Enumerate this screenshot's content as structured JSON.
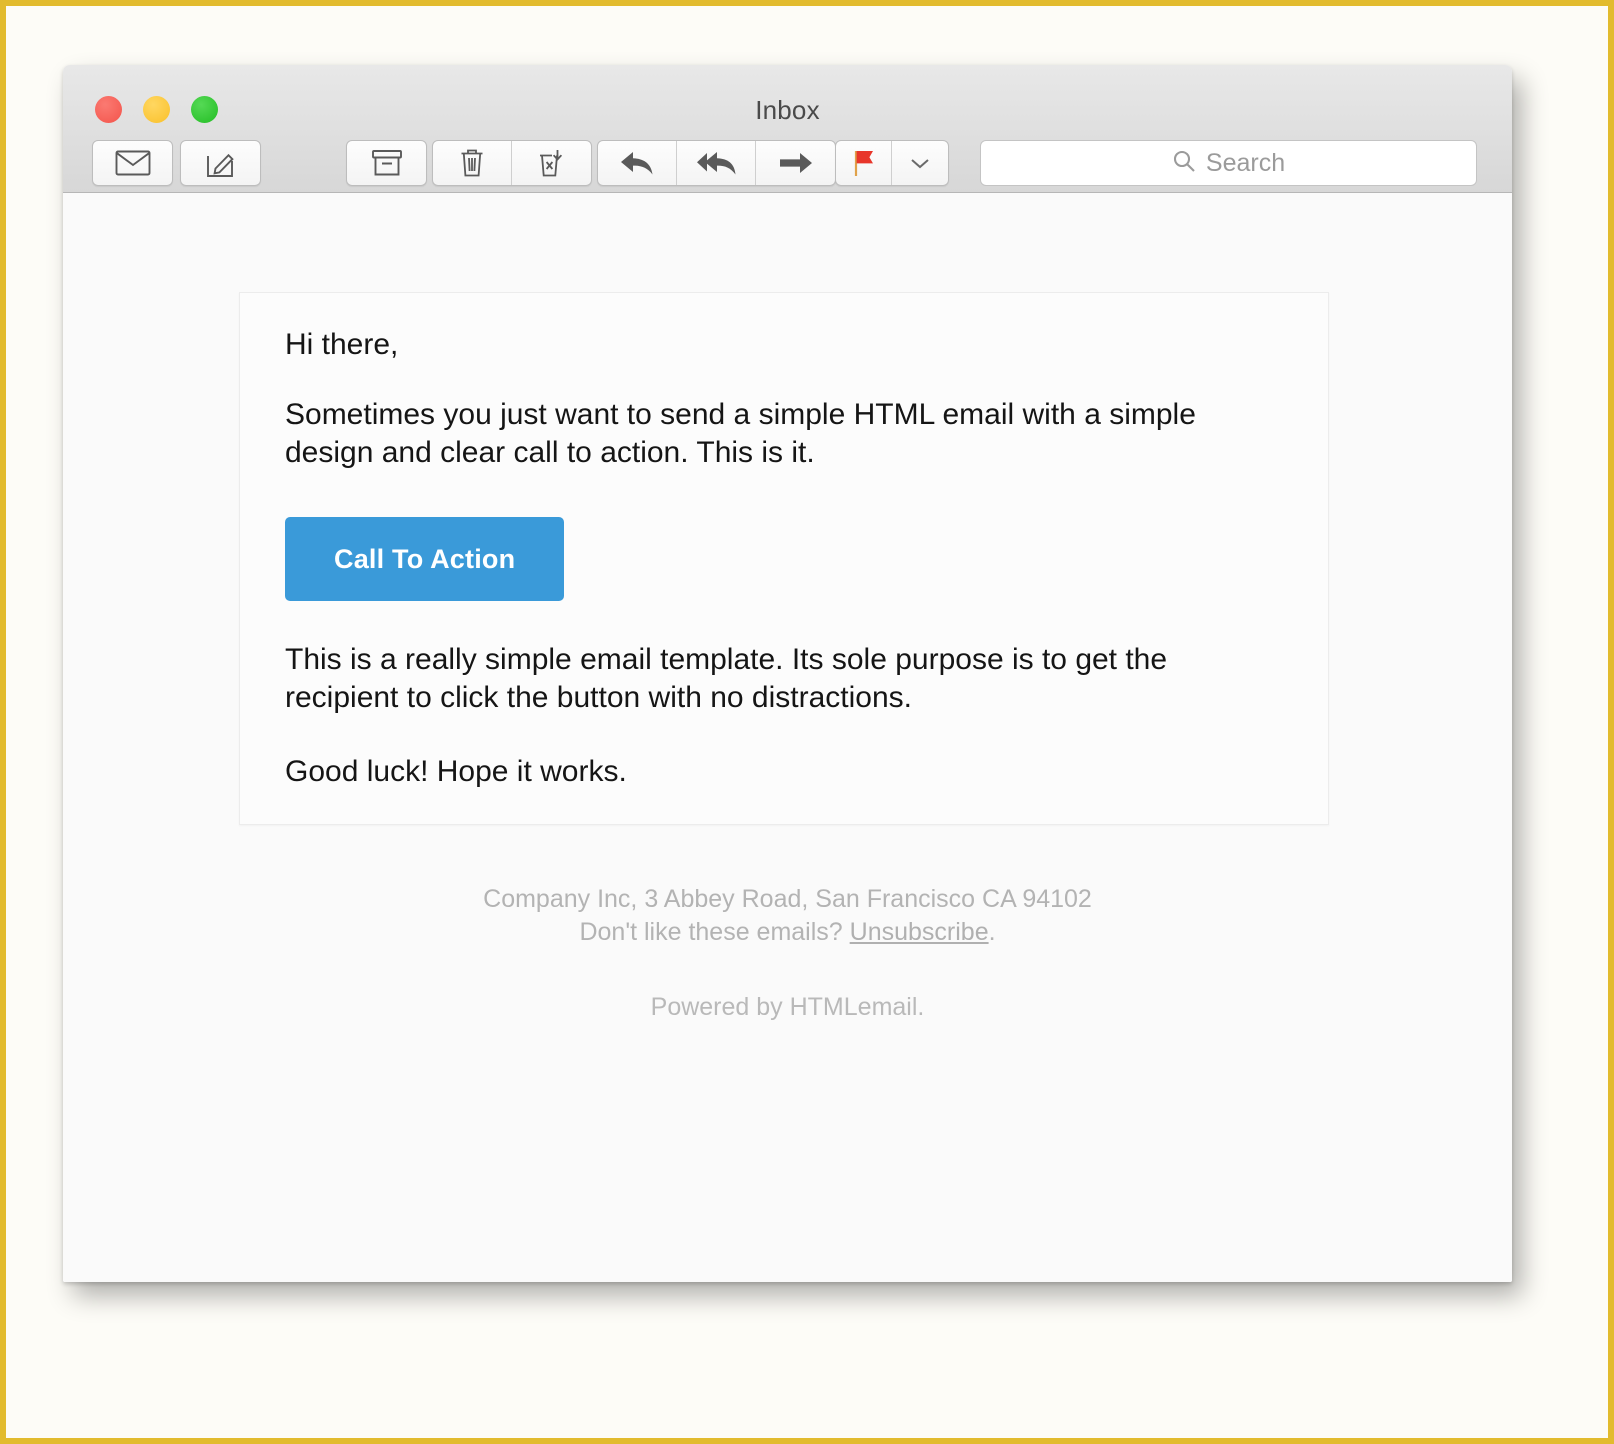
{
  "window": {
    "title": "Inbox",
    "traffic_lights": [
      {
        "name": "close",
        "color": "#f3544b"
      },
      {
        "name": "minimize",
        "color": "#f9c02a"
      },
      {
        "name": "zoom",
        "color": "#23bd24"
      }
    ]
  },
  "toolbar": {
    "buttons": [
      {
        "name": "get-mail",
        "icon": "envelope-icon",
        "label": "Get Mail"
      },
      {
        "name": "compose",
        "icon": "compose-icon",
        "label": "New Message"
      },
      {
        "name": "archive",
        "icon": "archive-box-icon",
        "label": "Archive"
      },
      {
        "name": "delete",
        "icon": "trash-icon",
        "label": "Delete"
      },
      {
        "name": "junk",
        "icon": "junk-mail-icon",
        "label": "Junk"
      },
      {
        "name": "reply",
        "icon": "reply-arrow-icon",
        "label": "Reply"
      },
      {
        "name": "reply-all",
        "icon": "reply-all-arrow-icon",
        "label": "Reply All"
      },
      {
        "name": "forward",
        "icon": "forward-arrow-icon",
        "label": "Forward"
      },
      {
        "name": "flag",
        "icon": "red-flag-icon",
        "label": "Flag"
      },
      {
        "name": "flag-menu",
        "icon": "chevron-down-icon",
        "label": "Flag Options"
      }
    ]
  },
  "search": {
    "placeholder": "Search",
    "value": "",
    "icon": "search-icon"
  },
  "email": {
    "greeting": "Hi there,",
    "paragraph_1": "Sometimes you just want to send a simple HTML email with a simple design and clear call to action. This is it.",
    "cta_label": "Call To Action",
    "cta_color": "#3a9ad9",
    "paragraph_2": "This is a really simple email template. Its sole purpose is to get the recipient to click the button with no distractions.",
    "paragraph_3": "Good luck! Hope it works."
  },
  "footer": {
    "address": "Company Inc, 3 Abbey Road, San Francisco CA 94102",
    "unsubscribe_prefix": "Don't like these emails? ",
    "unsubscribe_label": "Unsubscribe",
    "unsubscribe_suffix": ".",
    "powered_by": "Powered by HTMLemail."
  },
  "watermark": {
    "text": ""
  }
}
